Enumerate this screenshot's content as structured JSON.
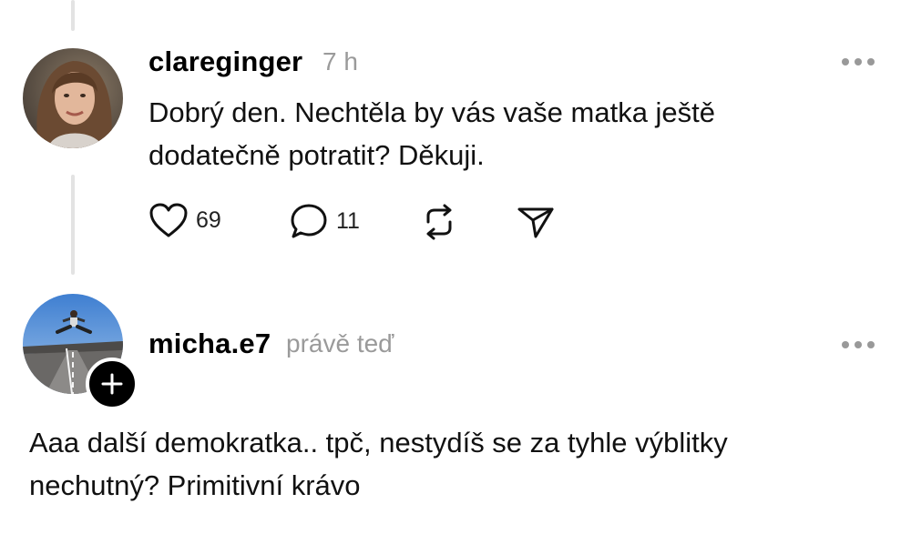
{
  "post1": {
    "username": "clareginger",
    "time": "7 h",
    "text": "Dobrý den. Nechtěla by vás vaše matka ještě\ndodatečně potratit? Děkuji.",
    "likes": "69",
    "replies": "11",
    "icons": [
      "heart-icon",
      "comment-icon",
      "repost-icon",
      "share-icon",
      "more-icon"
    ]
  },
  "post2": {
    "username": "micha.e7",
    "time": "právě teď",
    "text": "Aaa další demokratka.. tpč, nestydíš se za tyhle výblitky\nnechutný? Primitivní krávo",
    "icons": [
      "follow-plus-icon",
      "more-icon"
    ]
  },
  "colors": {
    "thread_line": "#e3e3e3",
    "meta_text": "#9a9a9a",
    "follow_button": "#000000"
  }
}
